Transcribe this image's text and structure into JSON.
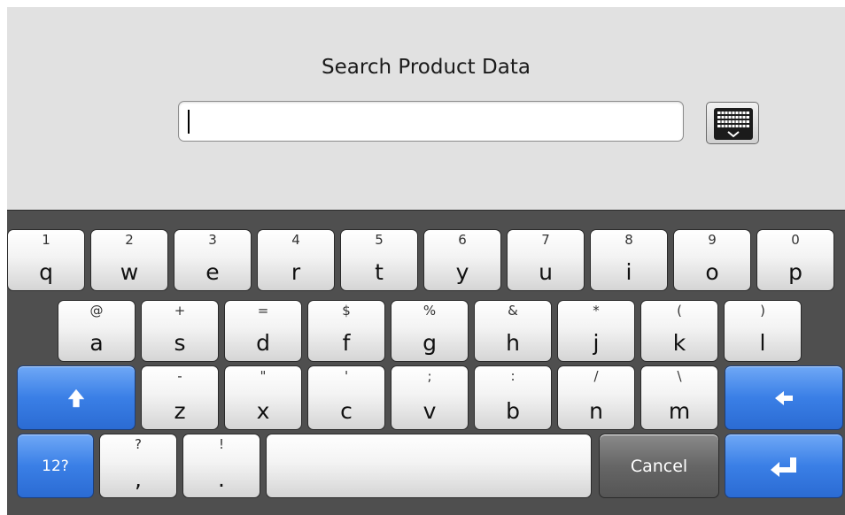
{
  "header": {
    "title": "Search Product Data",
    "search_value": ""
  },
  "keyboard": {
    "row1": [
      {
        "sec": "1",
        "pri": "q"
      },
      {
        "sec": "2",
        "pri": "w"
      },
      {
        "sec": "3",
        "pri": "e"
      },
      {
        "sec": "4",
        "pri": "r"
      },
      {
        "sec": "5",
        "pri": "t"
      },
      {
        "sec": "6",
        "pri": "y"
      },
      {
        "sec": "7",
        "pri": "u"
      },
      {
        "sec": "8",
        "pri": "i"
      },
      {
        "sec": "9",
        "pri": "o"
      },
      {
        "sec": "0",
        "pri": "p"
      }
    ],
    "row2": [
      {
        "sec": "@",
        "pri": "a"
      },
      {
        "sec": "+",
        "pri": "s"
      },
      {
        "sec": "=",
        "pri": "d"
      },
      {
        "sec": "$",
        "pri": "f"
      },
      {
        "sec": "%",
        "pri": "g"
      },
      {
        "sec": "&",
        "pri": "h"
      },
      {
        "sec": "*",
        "pri": "j"
      },
      {
        "sec": "(",
        "pri": "k"
      },
      {
        "sec": ")",
        "pri": "l"
      }
    ],
    "row3": [
      {
        "sec": "-",
        "pri": "z"
      },
      {
        "sec": "\"",
        "pri": "x"
      },
      {
        "sec": "'",
        "pri": "c"
      },
      {
        "sec": ";",
        "pri": "v"
      },
      {
        "sec": ":",
        "pri": "b"
      },
      {
        "sec": "/",
        "pri": "n"
      },
      {
        "sec": "\\",
        "pri": "m"
      }
    ],
    "row4": [
      {
        "sec": "?",
        "pri": ","
      },
      {
        "sec": "!",
        "pri": "."
      }
    ],
    "numbers_key_label": "12?",
    "cancel_label": "Cancel",
    "shift_icon": "shift-up-arrow-icon",
    "backspace_icon": "backspace-arrow-icon",
    "enter_icon": "enter-return-icon"
  },
  "colors": {
    "accent_blue": "#3a7fe6",
    "keyboard_bg": "#4f4f4f",
    "header_bg": "#e1e1e1"
  }
}
